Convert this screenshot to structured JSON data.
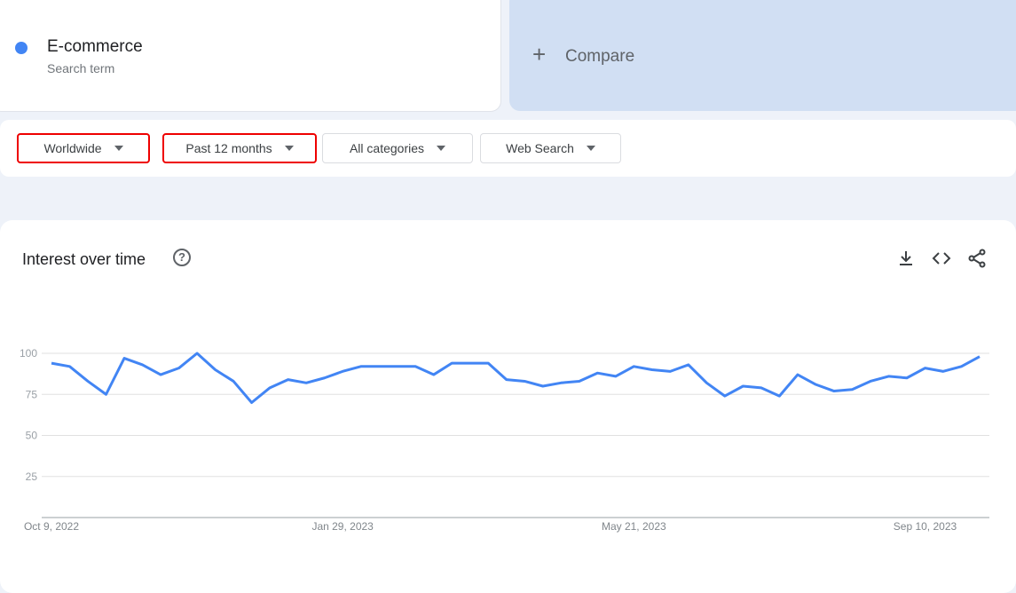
{
  "term": {
    "name": "E-commerce",
    "subtitle": "Search term",
    "color": "#4285f4"
  },
  "compare": {
    "icon": "plus-icon",
    "label": "Compare"
  },
  "filters": [
    {
      "label": "Worldwide",
      "highlighted": true
    },
    {
      "label": "Past 12 months",
      "highlighted": true
    },
    {
      "label": "All categories",
      "highlighted": false
    },
    {
      "label": "Web Search",
      "highlighted": false
    }
  ],
  "card": {
    "title": "Interest over time",
    "icons": [
      "help-icon",
      "download-icon",
      "embed-icon",
      "share-icon"
    ]
  },
  "chart_data": {
    "type": "line",
    "title": "",
    "ylim": [
      0,
      100
    ],
    "yticks": [
      25,
      50,
      75,
      100
    ],
    "xtick_labels": [
      {
        "label": "Oct 9, 2022",
        "index": 0
      },
      {
        "label": "Jan 29, 2023",
        "index": 16
      },
      {
        "label": "May 21, 2023",
        "index": 32
      },
      {
        "label": "Sep 10, 2023",
        "index": 48
      }
    ],
    "grid": true,
    "series": [
      {
        "color": "#4285f4",
        "values": [
          94,
          92,
          83,
          75,
          97,
          93,
          87,
          91,
          100,
          90,
          83,
          70,
          79,
          84,
          82,
          85,
          89,
          92,
          92,
          92,
          92,
          87,
          94,
          94,
          94,
          84,
          83,
          80,
          82,
          83,
          88,
          86,
          92,
          90,
          89,
          93,
          82,
          74,
          80,
          79,
          74,
          87,
          81,
          77,
          78,
          83,
          86,
          85,
          91,
          89,
          92,
          98
        ]
      }
    ]
  }
}
